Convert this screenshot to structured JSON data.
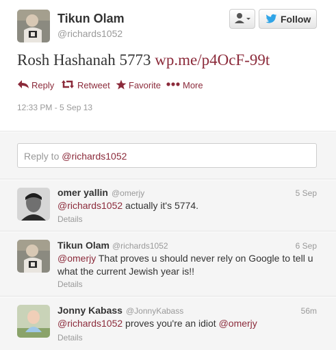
{
  "main_tweet": {
    "author_name": "Tikun Olam",
    "author_handle": "@richards1052",
    "text_plain": "Rosh Hashanah 5773",
    "text_link": "wp.me/p4OcF-99t",
    "actions": {
      "reply": "Reply",
      "retweet": "Retweet",
      "favorite": "Favorite",
      "more": "More"
    },
    "timestamp": "12:33 PM - 5 Sep 13",
    "follow_label": "Follow"
  },
  "reply_box": {
    "placeholder": "Reply to",
    "mention": "@richards1052"
  },
  "replies": [
    {
      "name": "omer yallin",
      "handle": "@omerjy",
      "time": "5 Sep",
      "mention": "@richards1052",
      "text": " actually it's 5774.",
      "details": "Details"
    },
    {
      "name": "Tikun Olam",
      "handle": "@richards1052",
      "time": "6 Sep",
      "mention": "@omerjy",
      "text": " That proves u should never rely on Google to tell u what the current Jewish year is!!",
      "details": "Details"
    },
    {
      "name": "Jonny Kabass",
      "handle": "@JonnyKabass",
      "time": "56m",
      "mention": "@richards1052",
      "text": " proves you're an idiot ",
      "mention2": "@omerjy",
      "details": "Details"
    }
  ],
  "colors": {
    "link": "#8b2a3a",
    "twitter_blue": "#2fa4e7"
  }
}
